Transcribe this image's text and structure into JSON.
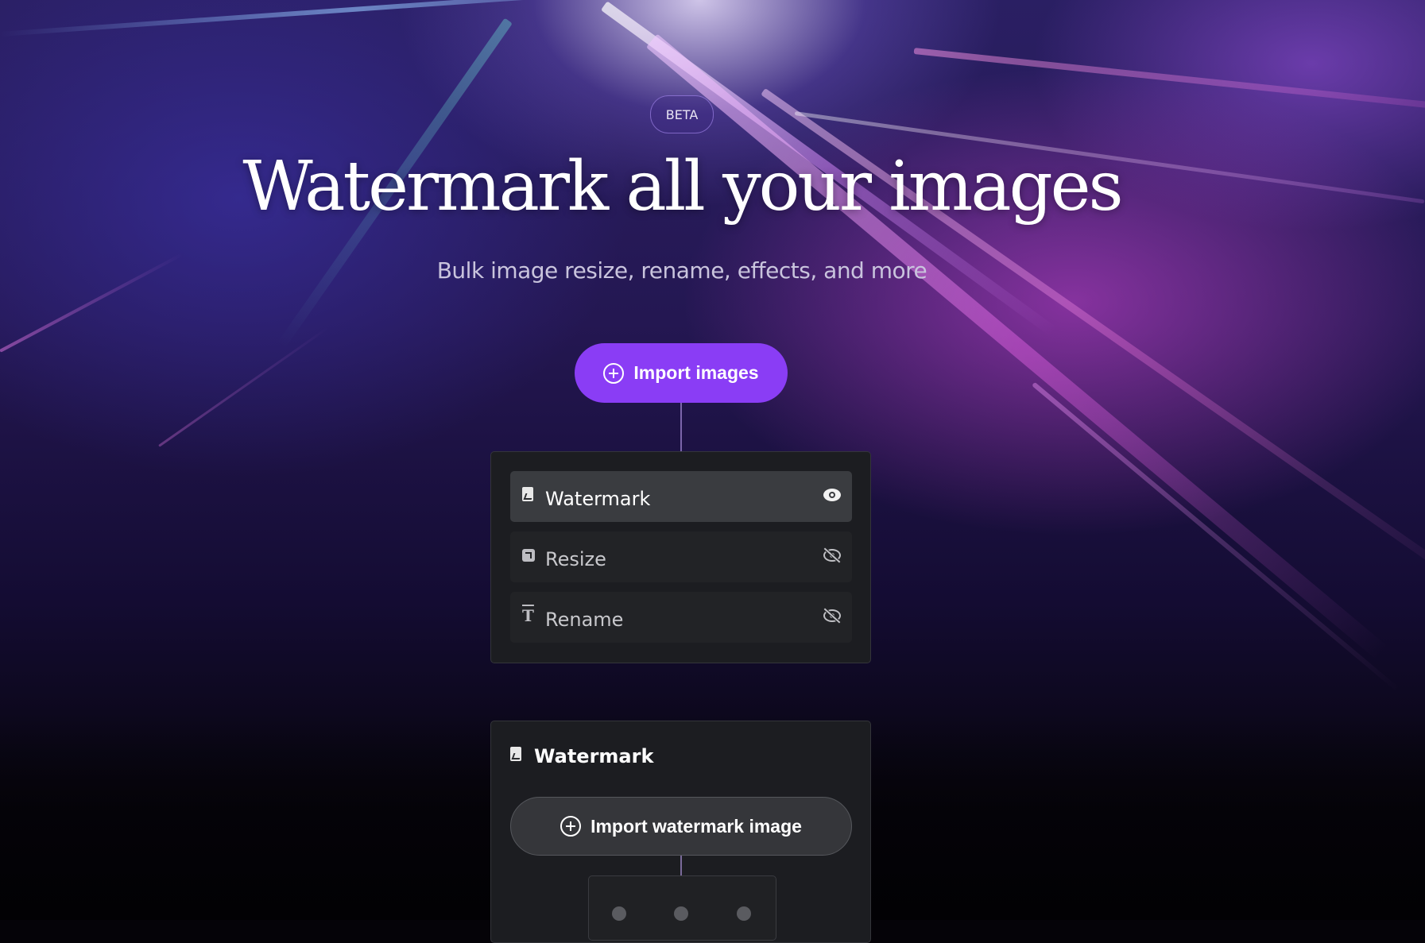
{
  "hero": {
    "badge": "BETA",
    "title": "Watermark all your images",
    "subtitle": "Bulk image resize, rename, effects, and more"
  },
  "import_button": {
    "label": "Import images",
    "icon": "plus-circle-icon"
  },
  "steps": [
    {
      "label": "Watermark",
      "icon": "document-image-icon",
      "visibility_icon": "eye-icon",
      "visible": true,
      "active": true
    },
    {
      "label": "Resize",
      "icon": "resize-icon",
      "visibility_icon": "eye-off-icon",
      "visible": false,
      "active": false
    },
    {
      "label": "Rename",
      "icon": "text-icon",
      "visibility_icon": "eye-off-icon",
      "visible": false,
      "active": false
    }
  ],
  "watermark_panel": {
    "title": "Watermark",
    "icon": "document-image-icon",
    "import_button": "Import watermark image",
    "import_icon": "plus-circle-icon",
    "position_dots": 3
  },
  "colors": {
    "accent": "#8a3df5",
    "panel": "#1c1d21",
    "step_active": "#3a3c40",
    "step": "#222326"
  }
}
